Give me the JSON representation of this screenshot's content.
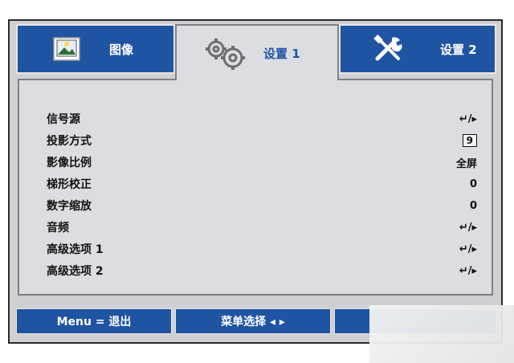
{
  "tabs": [
    {
      "label": "图像",
      "icon": "image-icon",
      "active": false
    },
    {
      "label": "设置 1",
      "icon": "gears-icon",
      "active": true
    },
    {
      "label": "设置 2",
      "icon": "tools-icon",
      "active": false
    }
  ],
  "menu": [
    {
      "label": "信号源",
      "value": "↵/▸"
    },
    {
      "label": "投影方式",
      "value": "9"
    },
    {
      "label": "影像比例",
      "value": "全屏"
    },
    {
      "label": "梯形校正",
      "value": "0"
    },
    {
      "label": "数字缩放",
      "value": "0"
    },
    {
      "label": "音频",
      "value": "↵/▸"
    },
    {
      "label": "高级选项 1",
      "value": "↵/▸"
    },
    {
      "label": "高级选项 2",
      "value": "↵/▸"
    }
  ],
  "bottom": {
    "exit": "Menu = 退出",
    "select": "菜单选择 ◂ ▸"
  },
  "colors": {
    "accent": "#1f54a3",
    "panel": "#dcdde1",
    "frame": "#cfd0d4"
  }
}
